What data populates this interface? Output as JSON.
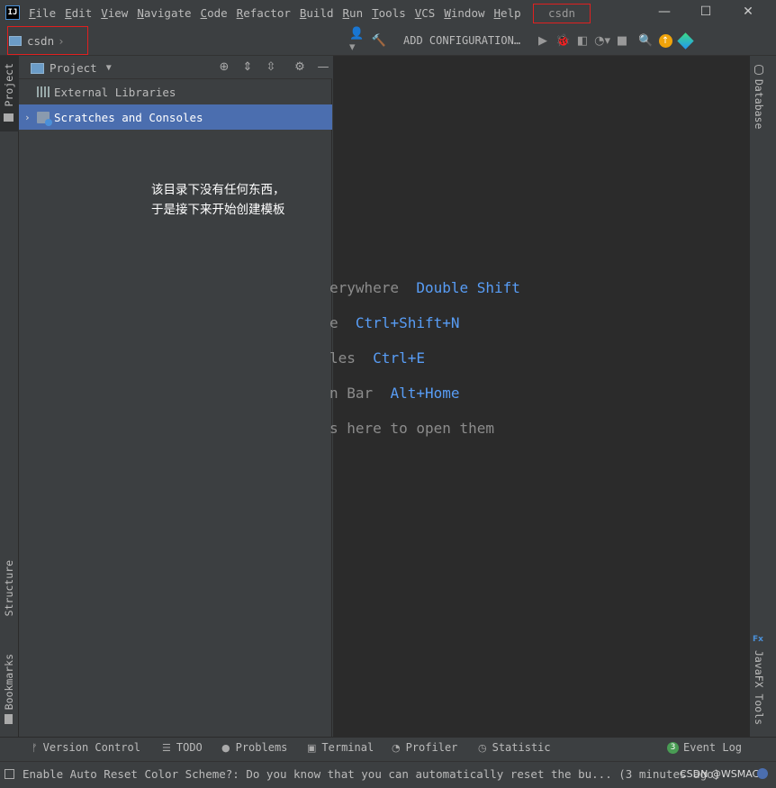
{
  "window": {
    "app_logo": "IJ",
    "project_title": "csdn",
    "controls": {
      "minimize": "—",
      "maximize": "☐",
      "close": "✕"
    }
  },
  "menu": [
    "File",
    "Edit",
    "View",
    "Navigate",
    "Code",
    "Refactor",
    "Build",
    "Run",
    "Tools",
    "VCS",
    "Window",
    "Help"
  ],
  "navbar": {
    "breadcrumb": "csdn",
    "breadcrumb_sep": "›",
    "add_configuration": "ADD CONFIGURATION…"
  },
  "left_stripe": {
    "project": "Project",
    "structure": "Structure",
    "bookmarks": "Bookmarks"
  },
  "right_stripe": {
    "database": "Database",
    "javafx": "JavaFX Tools",
    "javafx_badge": "Fx"
  },
  "project_panel": {
    "title": "Project",
    "items": [
      {
        "label": "External Libraries"
      },
      {
        "label": "Scratches and Consoles"
      }
    ]
  },
  "annotation": {
    "line1": "该目录下没有任何东西，",
    "line2": "于是接下来开始创建模板"
  },
  "editor_hints": [
    {
      "text": "erywhere",
      "key": "Double Shift"
    },
    {
      "text": "e",
      "key": "Ctrl+Shift+N"
    },
    {
      "text": "les",
      "key": "Ctrl+E"
    },
    {
      "text": "n Bar",
      "key": "Alt+Home"
    },
    {
      "text": "s here to open them",
      "key": ""
    }
  ],
  "bottom_tabs": {
    "version_control": "Version Control",
    "todo": "TODO",
    "problems": "Problems",
    "terminal": "Terminal",
    "profiler": "Profiler",
    "statistic": "Statistic",
    "event_log": "Event Log",
    "event_count": "3"
  },
  "status": {
    "message": "Enable Auto Reset Color Scheme?: Do you know that you can automatically reset the bu... (3 minutes ago)",
    "watermark": "CSDN @WSMACK"
  }
}
